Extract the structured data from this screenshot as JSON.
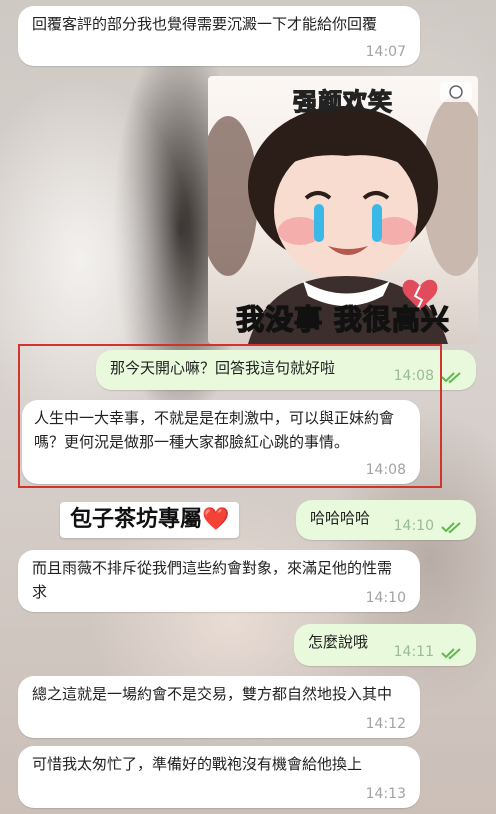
{
  "messages": [
    {
      "text": "回覆客評的部分我也覺得需要沉澱一下才能給你回覆",
      "time": "14:07"
    },
    {
      "sticker_top": "强颜欢笑",
      "sticker_bottom": "我没事 我很高兴"
    },
    {
      "text": "那今天開心嘛？回答我這句就好啦",
      "time": "14:08"
    },
    {
      "text": "人生中一大幸事，不就是是在刺激中，可以與正妹約會嗎？更何況是做那一種大家都臉紅心跳的事情。",
      "time": "14:08"
    },
    {
      "text": "哈哈哈哈",
      "time": "14:10"
    },
    {
      "text": "而且雨薇不排斥從我們這些約會對象，來滿足他的性需求",
      "time": "14:10"
    },
    {
      "text": "怎麼說哦",
      "time": "14:11"
    },
    {
      "text": "總之這就是一場約會不是交易，雙方都自然地投入其中",
      "time": "14:12"
    },
    {
      "text": "可惜我太匆忙了，準備好的戰袍沒有機會給他換上",
      "time": "14:13"
    }
  ],
  "label": {
    "text": "包子茶坊專屬",
    "emoji": "❤️"
  },
  "colors": {
    "outgoing_bubble": "#e8f9dc",
    "incoming_bubble": "#ffffff",
    "highlight": "#d0352b",
    "tick": "#5fba4f"
  }
}
